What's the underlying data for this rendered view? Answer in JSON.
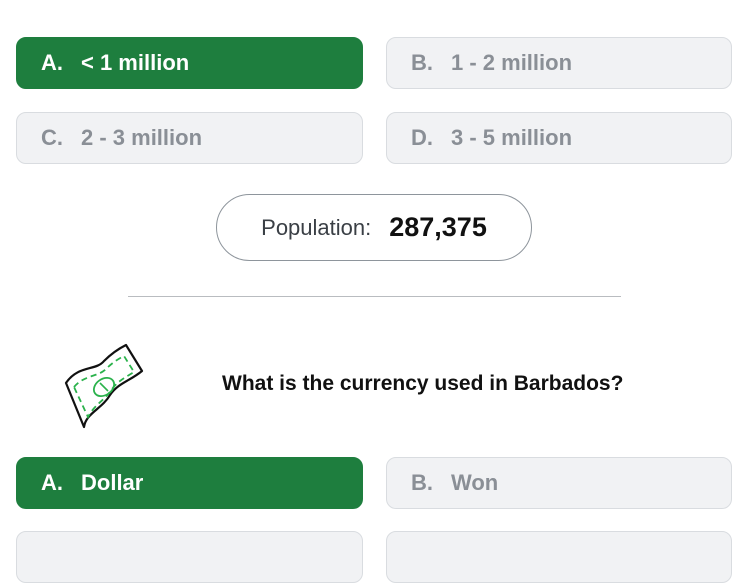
{
  "population_question": {
    "options": [
      {
        "letter": "A.",
        "text": "< 1 million",
        "selected": true
      },
      {
        "letter": "B.",
        "text": "1 - 2 million",
        "selected": false
      },
      {
        "letter": "C.",
        "text": "2 - 3 million",
        "selected": false
      },
      {
        "letter": "D.",
        "text": "3 - 5 million",
        "selected": false
      }
    ]
  },
  "population_fact": {
    "label": "Population:",
    "value": "287,375"
  },
  "currency_question": {
    "icon": "banknote-icon",
    "text": "What is the currency used in Barbados?",
    "options": [
      {
        "letter": "A.",
        "text": "Dollar",
        "selected": true
      },
      {
        "letter": "B.",
        "text": "Won",
        "selected": false
      }
    ]
  },
  "colors": {
    "selected": "#1e7e3e",
    "unselected_bg": "#f1f2f4",
    "unselected_text": "#8a8f96",
    "icon_green": "#2bb24c"
  }
}
